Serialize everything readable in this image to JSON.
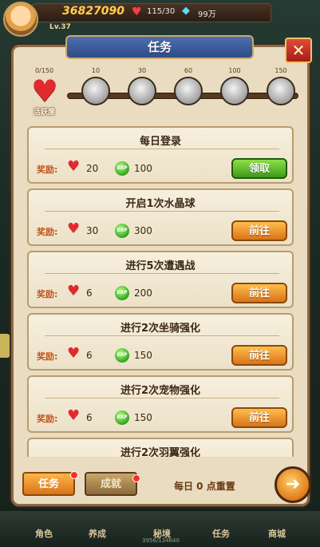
{
  "hud": {
    "level": "Lv.37",
    "gold": "36827090",
    "stamina": "115/30",
    "gems": "99万"
  },
  "panel": {
    "title": "任务",
    "close_icon": "close-icon"
  },
  "activity": {
    "label": "活跃度",
    "current": "0/150",
    "progress": 0,
    "milestones": [
      "10",
      "30",
      "60",
      "100",
      "150"
    ]
  },
  "tasks": [
    {
      "title": "每日登录",
      "reward_label": "奖励:",
      "heart": "20",
      "exp": "100",
      "button": "领取",
      "state": "claim"
    },
    {
      "title": "开启1次水晶球",
      "reward_label": "奖励:",
      "heart": "30",
      "exp": "300",
      "button": "前往",
      "state": "go"
    },
    {
      "title": "进行5次遭遇战",
      "reward_label": "奖励:",
      "heart": "6",
      "exp": "200",
      "button": "前往",
      "state": "go"
    },
    {
      "title": "进行2次坐骑强化",
      "reward_label": "奖励:",
      "heart": "6",
      "exp": "150",
      "button": "前往",
      "state": "go"
    },
    {
      "title": "进行2次宠物强化",
      "reward_label": "奖励:",
      "heart": "6",
      "exp": "150",
      "button": "前往",
      "state": "go"
    },
    {
      "title": "进行2次羽翼强化"
    }
  ],
  "exp_icon_text": "EXP",
  "tabs": {
    "active": "任务",
    "inactive": "成就"
  },
  "reset_text": "每日 0 点重置",
  "nav": {
    "items": [
      "角色",
      "养成",
      "秘境",
      "任务",
      "商城"
    ],
    "sub": "3956/134640"
  },
  "colors": {
    "accent": "#d9731a",
    "claim": "#3c9a18",
    "title_bar": "#2f4c86"
  }
}
